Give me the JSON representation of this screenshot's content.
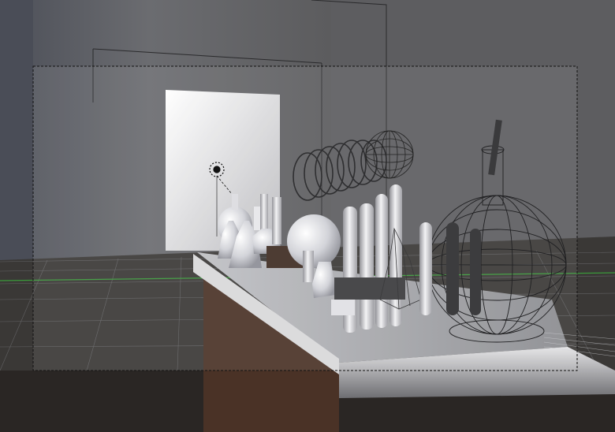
{
  "app": {
    "name": ""
  },
  "viewport": {
    "mode": "3D viewport",
    "shading": [
      "solid",
      "wireframe"
    ],
    "scene_objects": [
      {
        "name": "back-wall",
        "kind": "plane"
      },
      {
        "name": "doorway",
        "kind": "plane"
      },
      {
        "name": "lab-table",
        "kind": "mesh"
      },
      {
        "name": "round-flask-wireframe",
        "kind": "mesh"
      },
      {
        "name": "test-tube-rack",
        "kind": "mesh"
      },
      {
        "name": "erlenmeyer-flasks",
        "kind": "mesh"
      },
      {
        "name": "spiral-coil-condenser",
        "kind": "mesh"
      },
      {
        "name": "glass-sphere-wireframe",
        "kind": "mesh"
      },
      {
        "name": "point-lamp",
        "kind": "light"
      }
    ]
  },
  "colors": {
    "background": "#5a5a5c",
    "floor": "#2a2624",
    "camera_frame": "#111111",
    "axis_green": "#3a9a3a",
    "table_front": "#4a3226",
    "glass": "#e8e8ec"
  }
}
